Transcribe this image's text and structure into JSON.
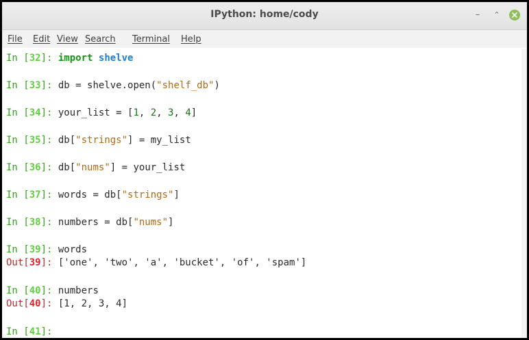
{
  "window": {
    "title": "IPython: home/cody",
    "controls": {
      "minimize": "–",
      "maximize": "⌃",
      "close": "×"
    }
  },
  "menubar": {
    "items": [
      "File",
      "Edit",
      "View",
      "Search",
      "Terminal",
      "Help"
    ]
  },
  "terminal": {
    "in_prefix": "In [",
    "out_prefix": "Out[",
    "prompt_suffix": "]: ",
    "cells": [
      {
        "in_num": "32",
        "code": [
          [
            "import",
            "kw"
          ],
          [
            " ",
            ""
          ],
          [
            "shelve",
            "mod"
          ]
        ]
      },
      {
        "in_num": "33",
        "code": [
          [
            "db = shelve.open(",
            ""
          ],
          [
            "\"shelf_db\"",
            "str"
          ],
          [
            ")",
            ""
          ]
        ]
      },
      {
        "in_num": "34",
        "code": [
          [
            "your_list = [",
            ""
          ],
          [
            "1",
            "num"
          ],
          [
            ", ",
            ""
          ],
          [
            "2",
            "num"
          ],
          [
            ", ",
            ""
          ],
          [
            "3",
            "num"
          ],
          [
            ", ",
            ""
          ],
          [
            "4",
            "num"
          ],
          [
            "]",
            ""
          ]
        ]
      },
      {
        "in_num": "35",
        "code": [
          [
            "db[",
            ""
          ],
          [
            "\"strings\"",
            "str"
          ],
          [
            "] = my_list",
            ""
          ]
        ]
      },
      {
        "in_num": "36",
        "code": [
          [
            "db[",
            ""
          ],
          [
            "\"nums\"",
            "str"
          ],
          [
            "] = your_list",
            ""
          ]
        ]
      },
      {
        "in_num": "37",
        "code": [
          [
            "words = db[",
            ""
          ],
          [
            "\"strings\"",
            "str"
          ],
          [
            "]",
            ""
          ]
        ]
      },
      {
        "in_num": "38",
        "code": [
          [
            "numbers = db[",
            ""
          ],
          [
            "\"nums\"",
            "str"
          ],
          [
            "]",
            ""
          ]
        ]
      },
      {
        "in_num": "39",
        "code": [
          [
            "words",
            ""
          ]
        ],
        "out_num": "39",
        "output": "['one', 'two', 'a', 'bucket', 'of', 'spam']"
      },
      {
        "in_num": "40",
        "code": [
          [
            "numbers",
            ""
          ]
        ],
        "out_num": "40",
        "output": "[1, 2, 3, 4]"
      },
      {
        "in_num": "41",
        "code": []
      }
    ]
  },
  "colors": {
    "in_prompt": "#33a318",
    "out_prompt": "#c5282e",
    "string": "#b06a14",
    "keyword": "#119611",
    "module": "#1e7fd0"
  }
}
